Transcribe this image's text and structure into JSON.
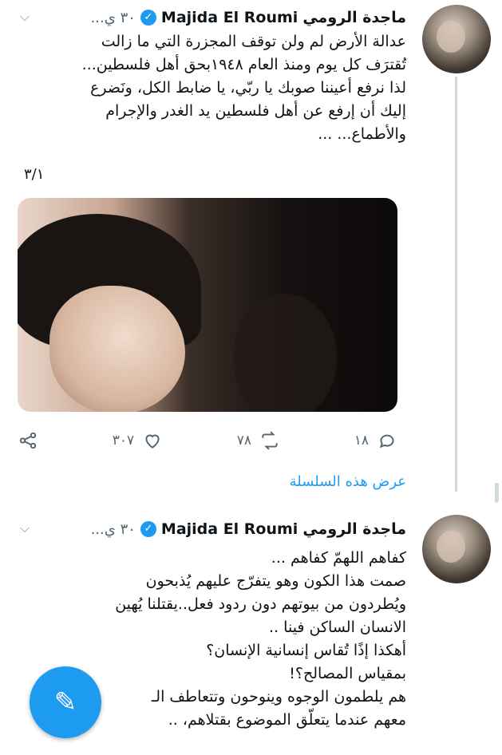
{
  "tweets": [
    {
      "author_name": "Majida El Roumi",
      "author_name_ar": "ماجدة الرومي",
      "time": "٣٠ ي...",
      "text_lines": [
        "عدالة الأرض لم ولن توقف المجزرة التي ما زالت",
        "تُقترَف كل  يوم ومنذ العام ١٩٤٨بحق أهل فلسطين...",
        "لذا نرفع أعيننا صوبك يا ربّي، يا ضابط الكل، ونَضرع",
        "إليك أن إرفع عن أهل فلسطين  يد الغدر والإجرام",
        "والأطماع... ..."
      ],
      "thread_counter": "٣/١",
      "actions": {
        "reply_count": "١٨",
        "retweet_count": "٧٨",
        "like_count": "٣٠٧"
      }
    },
    {
      "author_name": "Majida El Roumi",
      "author_name_ar": "ماجدة الرومي",
      "time": "٣٠ ي...",
      "text_lines": [
        "كفاهم اللهمّ كفاهم ...",
        " صمت هذا الكون وهو يتفرّج عليهم  يُذبحون",
        "ويُطردون من بيوتهم دون ردود فعل..يقتلنا يُهين",
        "الانسان الساكن فينا ..",
        "أهكذا إذًا تُقاس إنسانية الإنسان؟",
        " بمقياس المصالح؟!",
        "هم يلطمون الوجوه وينوحون وتتعاطف الـ",
        "معهم عندما يتعلّق الموضوع بقتلاهم، .."
      ]
    }
  ],
  "show_thread_label": "عرض هذه السلسلة",
  "icons": {
    "verified": "verified-badge-icon",
    "caret": "chevron-down-icon",
    "reply": "reply-icon",
    "retweet": "retweet-icon",
    "like": "heart-icon",
    "share": "share-icon",
    "compose": "compose-tweet-icon"
  },
  "colors": {
    "accent": "#1d9bf0",
    "secondary_text": "#536471",
    "thread_line": "#cfd9de"
  }
}
